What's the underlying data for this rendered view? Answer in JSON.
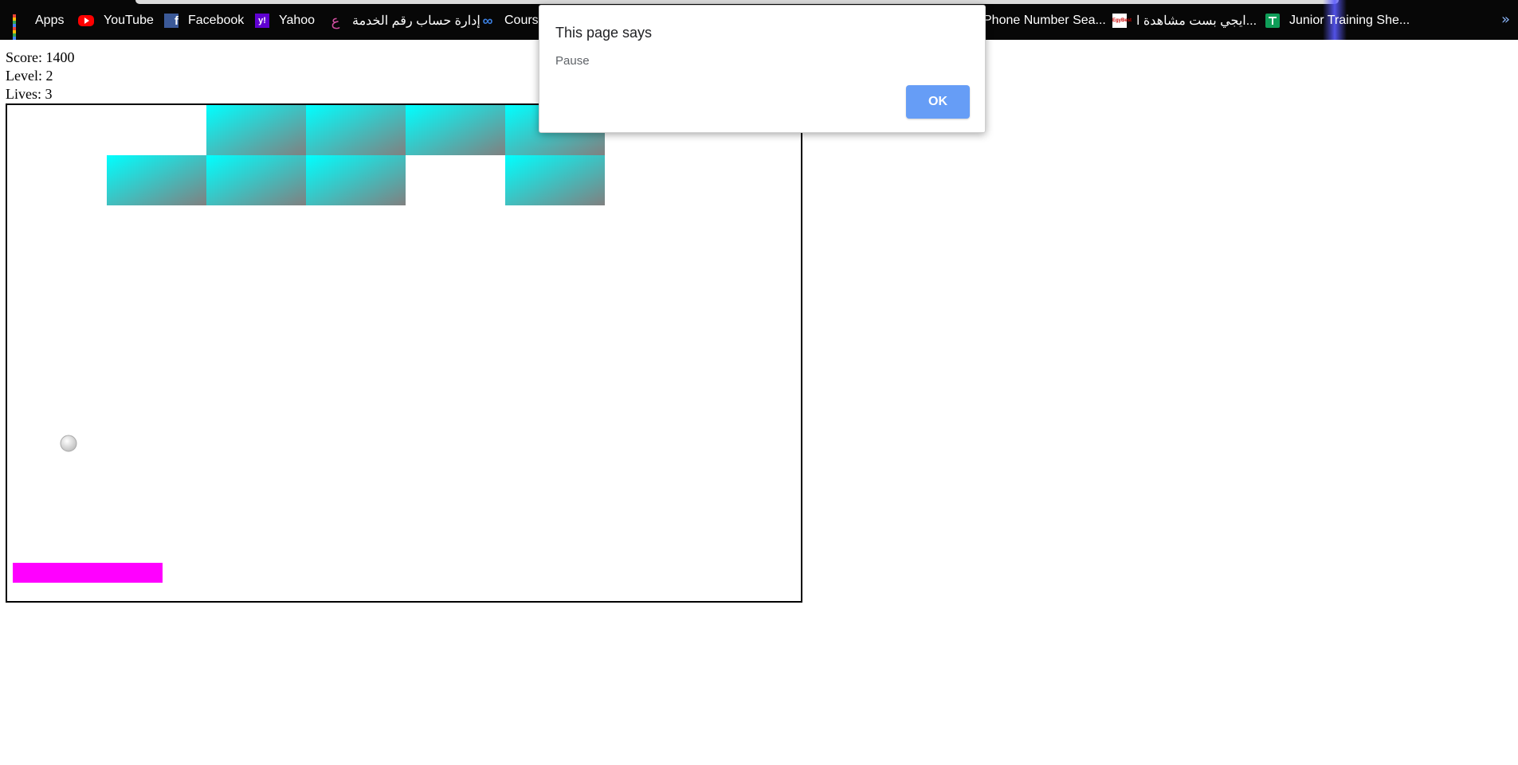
{
  "bookmarks": {
    "items": [
      {
        "label": "Apps",
        "icon": "apps-grid-icon"
      },
      {
        "label": "YouTube",
        "icon": "youtube-icon"
      },
      {
        "label": "Facebook",
        "icon": "facebook-icon"
      },
      {
        "label": "Yahoo",
        "icon": "yahoo-icon"
      },
      {
        "label": "إدارة حساب رقم الخدمة",
        "icon": "etisalat-icon"
      },
      {
        "label": "Course",
        "icon": "coursera-icon"
      },
      {
        "label": "Phone Number Sea...",
        "icon": ""
      },
      {
        "label": "ايجي بست مشاهدة ا...",
        "icon": "egybest-icon"
      },
      {
        "label": "Junior Training She...",
        "icon": "google-sheets-icon"
      }
    ],
    "more": "»"
  },
  "hud": {
    "score_label": "Score: 1400",
    "level_label": "Level: 2",
    "lives_label": "Lives: 3",
    "score": 1400,
    "level": 2,
    "lives": 3
  },
  "game": {
    "brick_rows": [
      [
        false,
        false,
        true,
        true,
        true,
        true,
        false,
        false
      ],
      [
        false,
        true,
        true,
        true,
        false,
        true,
        false,
        false
      ]
    ],
    "brick_colors": {
      "start": "#00ffff",
      "end": "#808080"
    },
    "paddle_color": "#ff00ff",
    "ball_color": "#c0c0c0"
  },
  "dialog": {
    "title": "This page says",
    "message": "Pause",
    "ok_label": "OK",
    "ok_color": "#669df6"
  }
}
